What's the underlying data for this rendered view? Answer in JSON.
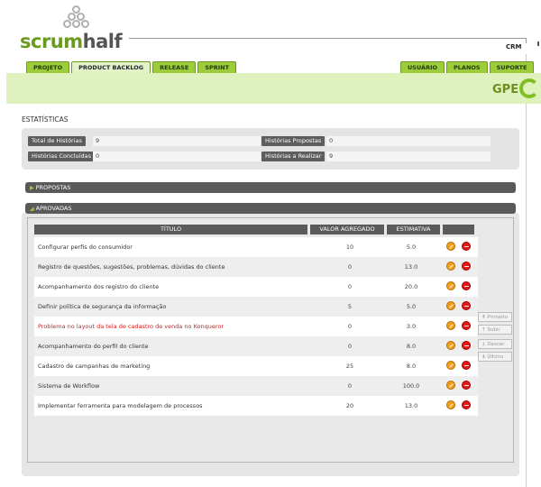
{
  "app": {
    "logo_green": "scrum",
    "logo_dark": "half",
    "project": "CRM",
    "gpe": "GPE"
  },
  "tabs_left": [
    "PROJETO",
    "PRODUCT BACKLOG",
    "RELEASE",
    "SPRINT"
  ],
  "tabs_right": [
    "USUÁRIO",
    "PLANOS",
    "SUPORTE"
  ],
  "active_tab": "PRODUCT BACKLOG",
  "stats": {
    "title": "ESTATÍSTICAS",
    "total_label": "Total de Histórias",
    "total_value": "9",
    "propostas_label": "Histórias Propostas",
    "propostas_value": "0",
    "concluidas_label": "Histórias Concluídas",
    "concluidas_value": "0",
    "realizar_label": "Histórias a Realizar",
    "realizar_value": "9"
  },
  "sections": {
    "propostas": "PROPOSTAS",
    "aprovadas": "APROVADAS"
  },
  "table": {
    "headers": {
      "titulo": "TÍTULO",
      "valor": "VALOR AGREGADO",
      "estimativa": "ESTIMATIVA"
    },
    "rows": [
      {
        "title": "Configurar perfis do consumidor",
        "value": "10",
        "estimate": "5.0"
      },
      {
        "title": "Registro de questões, sugestões, problemas, dúvidas do cliente",
        "value": "0",
        "estimate": "13.0"
      },
      {
        "title": "Acompanhamento dos registro do cliente",
        "value": "0",
        "estimate": "20.0"
      },
      {
        "title": "Definir política de segurança da informação",
        "value": "5",
        "estimate": "5.0"
      },
      {
        "title": "Problema no layout da tela de cadastro de venda no Konqueror",
        "value": "0",
        "estimate": "3.0",
        "highlight": true
      },
      {
        "title": "Acompanhamento do perfil do cliente",
        "value": "0",
        "estimate": "8.0"
      },
      {
        "title": "Cadastro de campanhas de marketing",
        "value": "25",
        "estimate": "8.0"
      },
      {
        "title": "Sistema de Workflow",
        "value": "0",
        "estimate": "100.0"
      },
      {
        "title": "Implementar ferramenta para modelagem de processos",
        "value": "20",
        "estimate": "13.0"
      }
    ]
  },
  "order_buttons": [
    "Primeiro",
    "Subir",
    "Descer",
    "Último"
  ],
  "colors": {
    "brand_green": "#9ccc3a",
    "highlight_red": "#d41f1f",
    "header_bar": "#dff2bd"
  }
}
